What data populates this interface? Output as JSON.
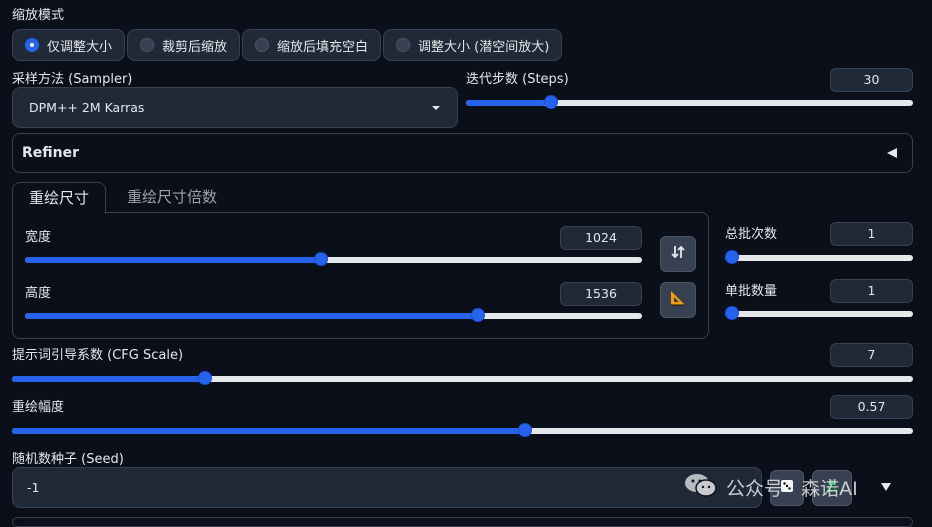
{
  "resize_mode": {
    "label": "缩放模式",
    "options": [
      "仅调整大小",
      "裁剪后缩放",
      "缩放后填充空白",
      "调整大小 (潜空间放大)"
    ],
    "selected": "仅调整大小"
  },
  "sampler": {
    "label": "采样方法 (Sampler)",
    "value": "DPM++ 2M Karras"
  },
  "steps": {
    "label": "迭代步数 (Steps)",
    "value": "30",
    "fraction": 0.18
  },
  "refiner": {
    "label": "Refiner"
  },
  "size_tabs": {
    "tabs": [
      "重绘尺寸",
      "重绘尺寸倍数"
    ],
    "active": "重绘尺寸"
  },
  "width": {
    "label": "宽度",
    "value": "1024",
    "fraction": 0.48
  },
  "height": {
    "label": "高度",
    "value": "1536",
    "fraction": 0.74
  },
  "batch_count": {
    "label": "总批次数",
    "value": "1",
    "fraction": 0.0
  },
  "batch_size": {
    "label": "单批数量",
    "value": "1",
    "fraction": 0.0
  },
  "cfg": {
    "label": "提示词引导系数 (CFG Scale)",
    "value": "7",
    "fraction": 0.21
  },
  "denoise": {
    "label": "重绘幅度",
    "value": "0.57",
    "fraction": 0.57
  },
  "seed": {
    "label": "随机数种子 (Seed)",
    "value": "-1"
  },
  "watermark": {
    "text": "公众号 · 森诺AI"
  },
  "icons": {
    "swap": "swap-dimensions-icon",
    "ratio": "triangle-ruler-icon",
    "dice": "dice-icon",
    "recycle": "recycle-icon"
  }
}
